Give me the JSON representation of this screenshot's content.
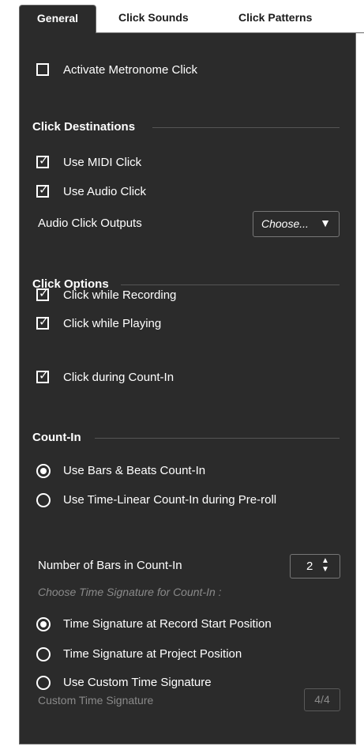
{
  "tabs": [
    {
      "label": "General",
      "active": true
    },
    {
      "label": "Click Sounds",
      "active": false
    },
    {
      "label": "Click Patterns",
      "active": false
    }
  ],
  "activate": {
    "label": "Activate Metronome Click",
    "checked": false
  },
  "click_destinations": {
    "title": "Click Destinations",
    "midi": {
      "label": "Use MIDI Click",
      "checked": true
    },
    "audio": {
      "label": "Use Audio Click",
      "checked": true
    },
    "outputs_label": "Audio Click Outputs",
    "outputs_value": "Choose...",
    "outputs_arrow": "▼"
  },
  "click_options": {
    "title": "Click Options",
    "recording": {
      "label": "Click while Recording",
      "checked": true
    },
    "playing": {
      "label": "Click while Playing",
      "checked": true
    },
    "countin": {
      "label": "Click during Count-In",
      "checked": true
    }
  },
  "count_in": {
    "title": "Count-In",
    "bars_beats": {
      "label": "Use Bars & Beats Count-In",
      "selected": true
    },
    "time_linear": {
      "label": "Use Time-Linear Count-In during Pre-roll",
      "selected": false
    },
    "bars_label": "Number of Bars in Count-In",
    "bars_value": "2",
    "ts_hint": "Choose Time Signature for Count-In :",
    "ts_record": {
      "label": "Time Signature at Record Start Position",
      "selected": true
    },
    "ts_project": {
      "label": "Time Signature at Project Position",
      "selected": false
    },
    "ts_custom": {
      "label": "Use Custom Time Signature",
      "selected": false
    },
    "custom_label": "Custom Time Signature",
    "custom_value": "4/4"
  },
  "colors": {
    "panel_bg": "#2b2b2b",
    "text": "#ffffff",
    "disabled_text": "#8a8a8a"
  }
}
